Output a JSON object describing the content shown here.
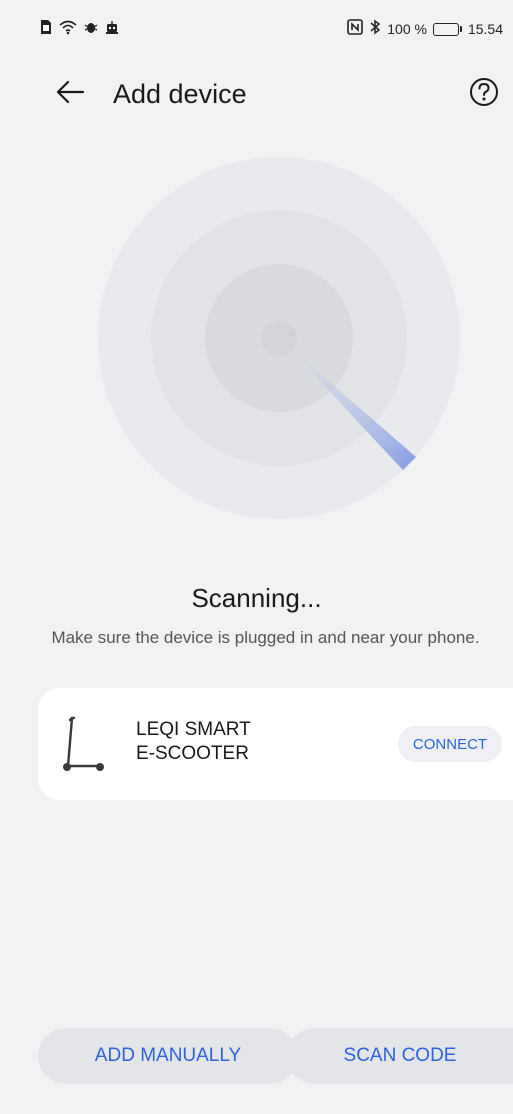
{
  "status_bar": {
    "left_icons": [
      "sim-icon",
      "wifi-icon",
      "bug-icon",
      "robot-icon"
    ],
    "nfc": "N",
    "bluetooth": "bluetooth-icon",
    "battery_percent": "100 %",
    "battery_level": 1.0,
    "time": "15.54"
  },
  "header": {
    "title": "Add device",
    "back_icon": "arrow-left-icon",
    "help_icon": "help-circle-icon"
  },
  "scan": {
    "status": "Scanning...",
    "hint": "Make sure the device is plugged in and near your phone."
  },
  "device": {
    "icon": "scooter-icon",
    "name_line1": "LEQI SMART",
    "name_line2": "E-SCOOTER",
    "connect_label": "CONNECT"
  },
  "actions": {
    "add_manually_label": "ADD MANUALLY",
    "scan_code_label": "SCAN CODE"
  },
  "colors": {
    "accent": "#2b63d9",
    "background": "#f1f2f4",
    "card": "#ffffff"
  }
}
